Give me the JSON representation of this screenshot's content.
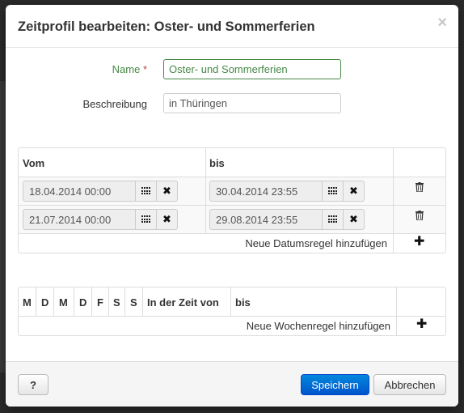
{
  "dialog": {
    "title": "Zeitprofil bearbeiten: Oster- und Sommerferien",
    "close_glyph": "×"
  },
  "form": {
    "name_label": "Name",
    "required_mark": "*",
    "name_value": "Oster- und Sommerferien",
    "description_label": "Beschreibung",
    "description_value": "in Thüringen"
  },
  "date_rules": {
    "headers": {
      "from": "Vom",
      "to": "bis"
    },
    "rows": [
      {
        "from": "18.04.2014 00:00",
        "to": "30.04.2014 23:55"
      },
      {
        "from": "21.07.2014 00:00",
        "to": "29.08.2014 23:55"
      }
    ],
    "add_label": "Neue Datumsregel hinzufügen",
    "clear_glyph": "✖",
    "add_glyph": "✚"
  },
  "week_rules": {
    "day_headers": [
      "M",
      "D",
      "M",
      "D",
      "F",
      "S",
      "S"
    ],
    "time_from_header": "In der Zeit von",
    "time_to_header": "bis",
    "add_label": "Neue Wochenregel hinzufügen",
    "add_glyph": "✚"
  },
  "footer": {
    "help_label": "?",
    "save_label": "Speichern",
    "cancel_label": "Abbrechen"
  },
  "colors": {
    "success": "#468847",
    "required": "#b94a48",
    "primary": "#0055cc"
  },
  "icons": [
    "close-icon",
    "calendar-icon",
    "clear-icon",
    "trash-icon",
    "plus-icon"
  ]
}
